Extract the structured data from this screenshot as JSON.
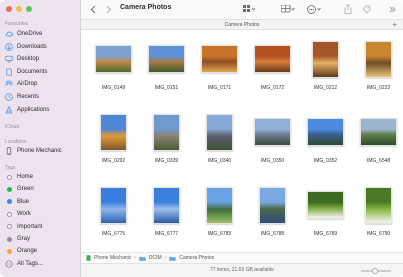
{
  "window": {
    "title": "Camera Photos",
    "traffic_colors": [
      "#ee6a5f",
      "#f5bd4f",
      "#61c554"
    ]
  },
  "sidebar": {
    "favourites_heading": "Favourites",
    "favourites": [
      {
        "label": "OneDrive",
        "icon": "cloud-icon"
      },
      {
        "label": "Downloads",
        "icon": "download-icon"
      },
      {
        "label": "Desktop",
        "icon": "desktop-icon"
      },
      {
        "label": "Documents",
        "icon": "document-icon"
      },
      {
        "label": "AirDrop",
        "icon": "airdrop-icon"
      },
      {
        "label": "Recents",
        "icon": "clock-icon"
      },
      {
        "label": "Applications",
        "icon": "applications-icon"
      }
    ],
    "icloud_heading": "iCloud",
    "locations_heading": "Locations",
    "locations": [
      {
        "label": "Phone Mechanic",
        "icon": "phone-icon"
      }
    ],
    "tags_heading": "Tags",
    "tags": [
      {
        "label": "Home",
        "color": "#ffffff"
      },
      {
        "label": "Green",
        "color": "#2fb24b"
      },
      {
        "label": "Blue",
        "color": "#3b82f6"
      },
      {
        "label": "Work",
        "color": "#ffffff"
      },
      {
        "label": "Important",
        "color": "#ffffff"
      },
      {
        "label": "Gray",
        "color": "#8e8e93"
      },
      {
        "label": "Orange",
        "color": "#f7a23b"
      },
      {
        "label": "All Tags...",
        "color": ""
      }
    ]
  },
  "toolbar": {
    "title": "Camera Photos",
    "back_icon": "chevron-left-icon",
    "forward_icon": "chevron-right-icon",
    "view_icon": "grid-view-icon",
    "group_icon": "group-icon",
    "action_icon": "more-icon",
    "share_icon": "share-icon",
    "tag_icon": "tag-icon",
    "more_icon": "chevron-double-right-icon"
  },
  "path_header": {
    "label": "Camera Photos"
  },
  "files": [
    {
      "name": "IMG_0149",
      "palette": [
        "#7da1cf",
        "#c28a4b",
        "#4f6a2e"
      ],
      "portrait": false
    },
    {
      "name": "IMG_0151",
      "palette": [
        "#5d91d8",
        "#a87a47",
        "#3f5f2c"
      ],
      "portrait": false
    },
    {
      "name": "IMG_0171",
      "palette": [
        "#c8732a",
        "#8c4e1e",
        "#e2a253"
      ],
      "portrait": false
    },
    {
      "name": "IMG_0172",
      "palette": [
        "#b3511f",
        "#d77e3a",
        "#6a3b1a"
      ],
      "portrait": false
    },
    {
      "name": "IMG_0212",
      "palette": [
        "#a55627",
        "#e6b265",
        "#5c3a1c"
      ],
      "portrait": true
    },
    {
      "name": "IMG_0222",
      "palette": [
        "#c9862f",
        "#6f4d24",
        "#e7c27a"
      ],
      "portrait": true
    },
    {
      "name": "IMG_0292",
      "palette": [
        "#4f86d6",
        "#e09b36",
        "#7c5a2c"
      ],
      "portrait": true
    },
    {
      "name": "IMG_0339",
      "palette": [
        "#6f99cf",
        "#8b8272",
        "#4b5a38"
      ],
      "portrait": true
    },
    {
      "name": "IMG_0340",
      "palette": [
        "#86a8d4",
        "#5a6070",
        "#3e5233"
      ],
      "portrait": true
    },
    {
      "name": "IMG_0350",
      "palette": [
        "#8fb1d8",
        "#6d7e8f",
        "#3c4a3c"
      ],
      "portrait": false
    },
    {
      "name": "IMG_0352",
      "palette": [
        "#4d8be0",
        "#3a5e8e",
        "#2f4a2f"
      ],
      "portrait": false
    },
    {
      "name": "IMG_6548",
      "palette": [
        "#9bb4cf",
        "#5f7e48",
        "#2e4d2a"
      ],
      "portrait": false
    },
    {
      "name": "IMG_6775",
      "palette": [
        "#3a7fe0",
        "#8fb7ea",
        "#2e63b4"
      ],
      "portrait": true
    },
    {
      "name": "IMG_6777",
      "palette": [
        "#3b80de",
        "#9ec0eb",
        "#275aa6"
      ],
      "portrait": true
    },
    {
      "name": "IMG_6785",
      "palette": [
        "#6aa2e6",
        "#3f6e3f",
        "#9bbf63"
      ],
      "portrait": true
    },
    {
      "name": "IMG_6788",
      "palette": [
        "#7aa8e0",
        "#496a4a",
        "#2e4c7c"
      ],
      "portrait": true
    },
    {
      "name": "IMG_6789",
      "palette": [
        "#3d6b22",
        "#78a33b",
        "#f5f5f0"
      ],
      "portrait": false
    },
    {
      "name": "IMG_6790",
      "palette": [
        "#4a7a28",
        "#86b546",
        "#f5f5f0"
      ],
      "portrait": true
    }
  ],
  "path_bar": {
    "segments": [
      "Phone Mechanic",
      "DCIM",
      "Camera Photos"
    ]
  },
  "status_bar": {
    "text": "77 items, 21.65 GB available",
    "zoom_level": 0.45
  }
}
